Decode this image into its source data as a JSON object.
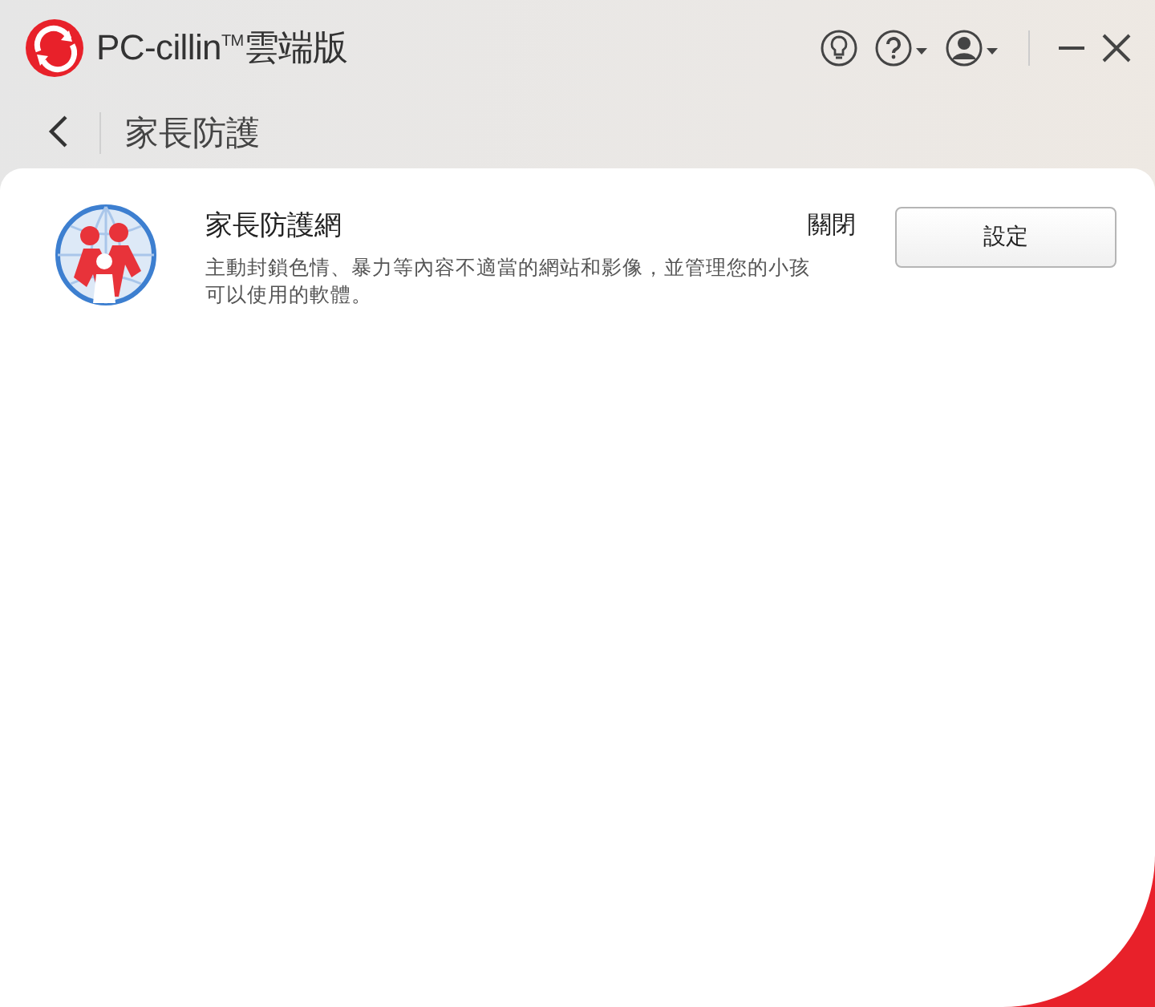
{
  "app": {
    "title": "PC-cillin$^{TM}$雲端版"
  },
  "page": {
    "title": "家長防護"
  },
  "features": [
    {
      "name": "家長防護網",
      "status": "關閉",
      "description": "主動封鎖色情、暴力等內容不適當的網站和影像，並管理您的小孩可以使用的軟體。",
      "button": "設定"
    }
  ]
}
